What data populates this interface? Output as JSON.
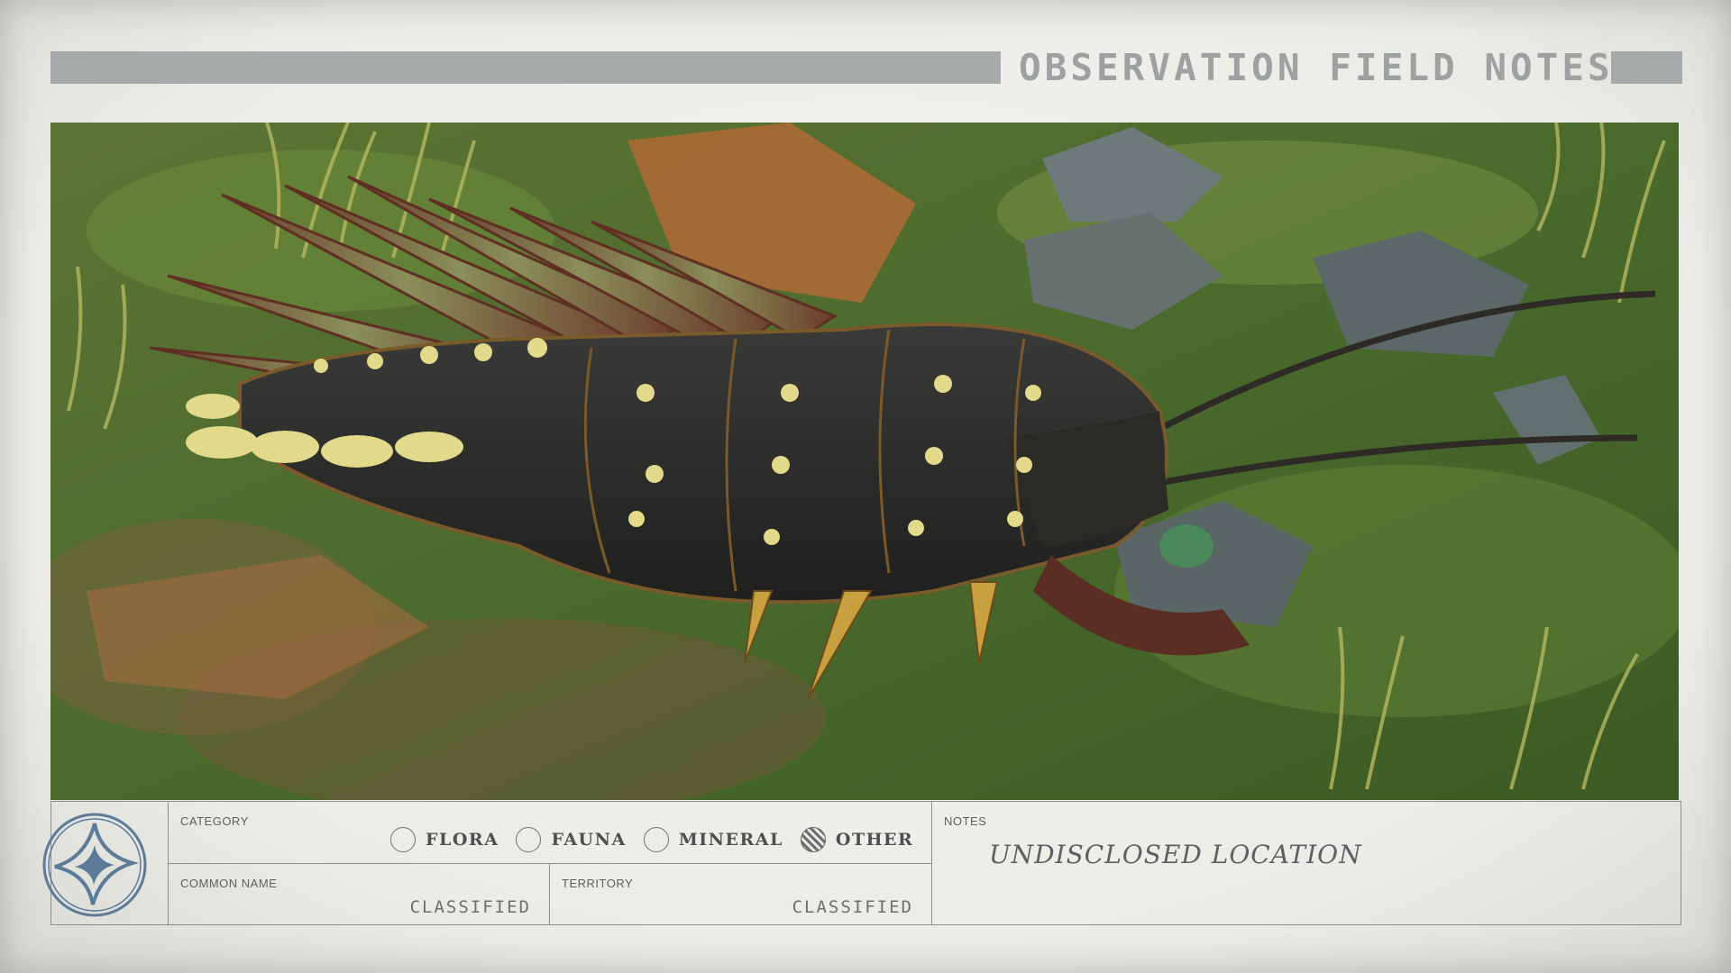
{
  "header": {
    "title": "OBSERVATION FIELD NOTES"
  },
  "photo": {
    "subject": "creature-specimen-photo"
  },
  "form": {
    "category": {
      "label": "CATEGORY",
      "options": [
        {
          "label": "FLORA",
          "selected": false
        },
        {
          "label": "FAUNA",
          "selected": false
        },
        {
          "label": "MINERAL",
          "selected": false
        },
        {
          "label": "OTHER",
          "selected": true
        }
      ]
    },
    "common_name": {
      "label": "COMMON NAME",
      "value": "CLASSIFIED"
    },
    "territory": {
      "label": "TERRITORY",
      "value": "CLASSIFIED"
    },
    "notes": {
      "label": "NOTES",
      "value": "UNDISCLOSED LOCATION"
    }
  },
  "logo": {
    "icon": "four-point-star-emblem"
  },
  "colors": {
    "paper": "#ecece7",
    "bar": "#a7aaab",
    "ink": "#5c5f60"
  }
}
